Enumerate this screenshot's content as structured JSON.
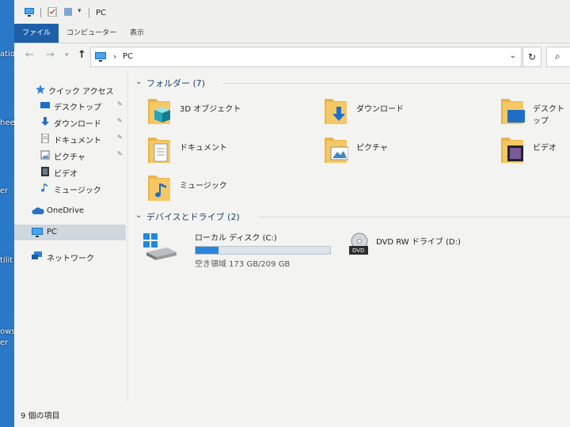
{
  "desktop": {
    "labels": [
      "ation",
      "heet",
      "er",
      "tilit",
      "ows",
      "er"
    ]
  },
  "titlebar": {
    "title": "PC"
  },
  "ribbon": {
    "tabs": [
      {
        "label": "ファイル",
        "active": true
      },
      {
        "label": "コンピューター"
      },
      {
        "label": "表示"
      }
    ]
  },
  "address": {
    "path": "PC",
    "separator": "›"
  },
  "sidebar": {
    "items": [
      {
        "label": "クイック アクセス",
        "icon": "star-icon"
      },
      {
        "label": "デスクトップ",
        "icon": "desktop-icon",
        "pinned": true
      },
      {
        "label": "ダウンロード",
        "icon": "download-icon",
        "pinned": true
      },
      {
        "label": "ドキュメント",
        "icon": "document-icon",
        "pinned": true
      },
      {
        "label": "ピクチャ",
        "icon": "picture-icon",
        "pinned": true
      },
      {
        "label": "ビデオ",
        "icon": "video-icon"
      },
      {
        "label": "ミュージック",
        "icon": "music-icon"
      },
      {
        "label": "OneDrive",
        "icon": "cloud-icon"
      },
      {
        "label": "PC",
        "icon": "pc-icon",
        "selected": true
      },
      {
        "label": "ネットワーク",
        "icon": "network-icon"
      }
    ]
  },
  "folders": {
    "header": "フォルダー (7)",
    "items": [
      {
        "label": "3D オブジェクト",
        "icon": "folder-3d-icon"
      },
      {
        "label": "ダウンロード",
        "icon": "folder-download-icon"
      },
      {
        "label": "デスクトップ",
        "icon": "folder-desktop-icon"
      },
      {
        "label": "ドキュメント",
        "icon": "folder-document-icon"
      },
      {
        "label": "ピクチャ",
        "icon": "folder-picture-icon"
      },
      {
        "label": "ビデオ",
        "icon": "folder-video-icon"
      },
      {
        "label": "ミュージック",
        "icon": "folder-music-icon"
      }
    ]
  },
  "devices": {
    "header": "デバイスとドライブ (2)",
    "drives": [
      {
        "label": "ローカル ディスク (C:)",
        "free_text": "空き領域 173 GB/209 GB",
        "used_fraction": 0.17,
        "icon": "windows-drive-icon"
      },
      {
        "label": "DVD RW ドライブ (D:)",
        "icon": "dvd-drive-icon",
        "badge": "DVD"
      }
    ]
  },
  "status": {
    "text": "9 個の項目"
  },
  "colors": {
    "accent": "#1f5fa8",
    "bar_fill": "#2a86d8",
    "folder": "#e8b54a",
    "selected": "#cfd8df"
  }
}
